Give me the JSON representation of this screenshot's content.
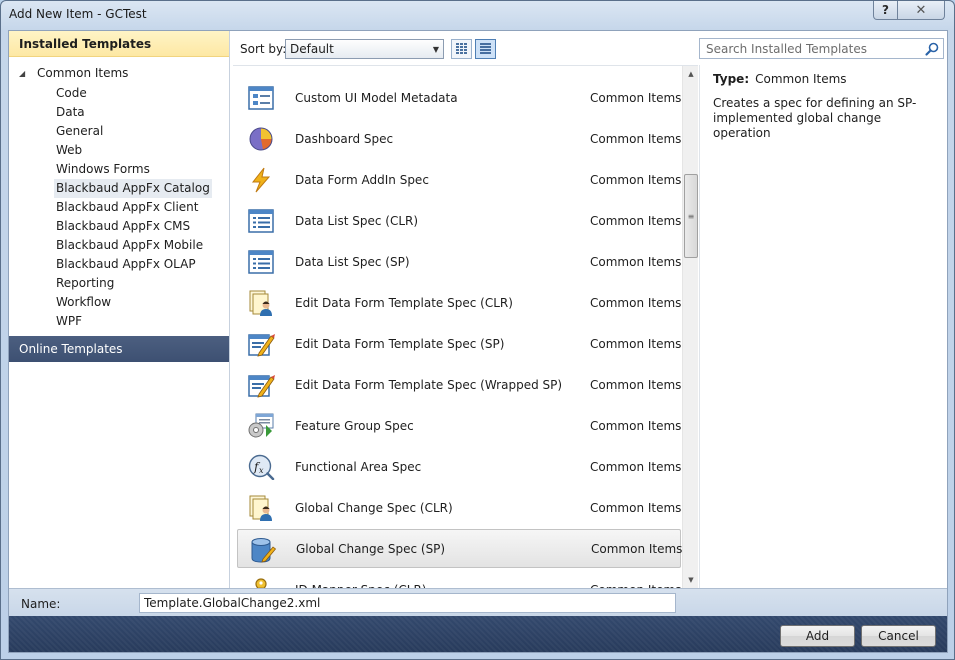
{
  "window": {
    "title": "Add New Item - GCTest",
    "help_label": "?",
    "close_label": "✕"
  },
  "left": {
    "installed_header": "Installed Templates",
    "root": "Common Items",
    "items": [
      "Code",
      "Web",
      "General",
      "Web",
      "Windows Forms",
      "Blackbaud AppFx Catalog",
      "Blackbaud AppFx Client",
      "Blackbaud AppFx CMS",
      "Blackbaud AppFx Mobile",
      "Blackbaud AppFx OLAP",
      "Reporting",
      "Workflow",
      "WPF"
    ],
    "items_fixed": [
      "Code",
      "Data",
      "General",
      "Web",
      "Windows Forms",
      "Blackbaud AppFx Catalog",
      "Blackbaud AppFx Client",
      "Blackbaud AppFx CMS",
      "Blackbaud AppFx Mobile",
      "Blackbaud AppFx OLAP",
      "Reporting",
      "Workflow",
      "WPF"
    ],
    "selected_index": 5,
    "online_header": "Online Templates"
  },
  "toolbar": {
    "sort_label": "Sort by:",
    "sort_value": "Default",
    "selected_view": "list"
  },
  "search": {
    "placeholder": "Search Installed Templates"
  },
  "templates": [
    {
      "name": "Custom UI Model Metadata",
      "category": "Common Items",
      "icon": "ui-model-icon"
    },
    {
      "name": "Dashboard Spec",
      "category": "Common Items",
      "icon": "dashboard-icon"
    },
    {
      "name": "Data Form AddIn Spec",
      "category": "Common Items",
      "icon": "lightning-icon"
    },
    {
      "name": "Data List Spec (CLR)",
      "category": "Common Items",
      "icon": "data-list-icon"
    },
    {
      "name": "Data List Spec (SP)",
      "category": "Common Items",
      "icon": "data-list-icon"
    },
    {
      "name": "Edit Data Form Template Spec (CLR)",
      "category": "Common Items",
      "icon": "user-document-icon"
    },
    {
      "name": "Edit Data Form Template Spec (SP)",
      "category": "Common Items",
      "icon": "edit-form-icon"
    },
    {
      "name": "Edit Data Form Template Spec (Wrapped SP)",
      "category": "Common Items",
      "icon": "edit-form-icon"
    },
    {
      "name": "Feature Group Spec",
      "category": "Common Items",
      "icon": "feature-group-icon"
    },
    {
      "name": "Functional Area Spec",
      "category": "Common Items",
      "icon": "function-icon"
    },
    {
      "name": "Global Change Spec (CLR)",
      "category": "Common Items",
      "icon": "user-document-icon"
    },
    {
      "name": "Global Change Spec (SP)",
      "category": "Common Items",
      "icon": "database-icon"
    },
    {
      "name": "ID Mapper Spec (CLR)",
      "category": "Common Items",
      "icon": "key-icon"
    }
  ],
  "selected_template_index": 11,
  "details": {
    "type_label": "Type:",
    "type_value": "Common Items",
    "description": "Creates a spec for defining an SP-implemented global change operation"
  },
  "footer": {
    "name_label": "Name:",
    "name_value": "Template.GlobalChange2.xml",
    "add_label": "Add",
    "cancel_label": "Cancel"
  }
}
